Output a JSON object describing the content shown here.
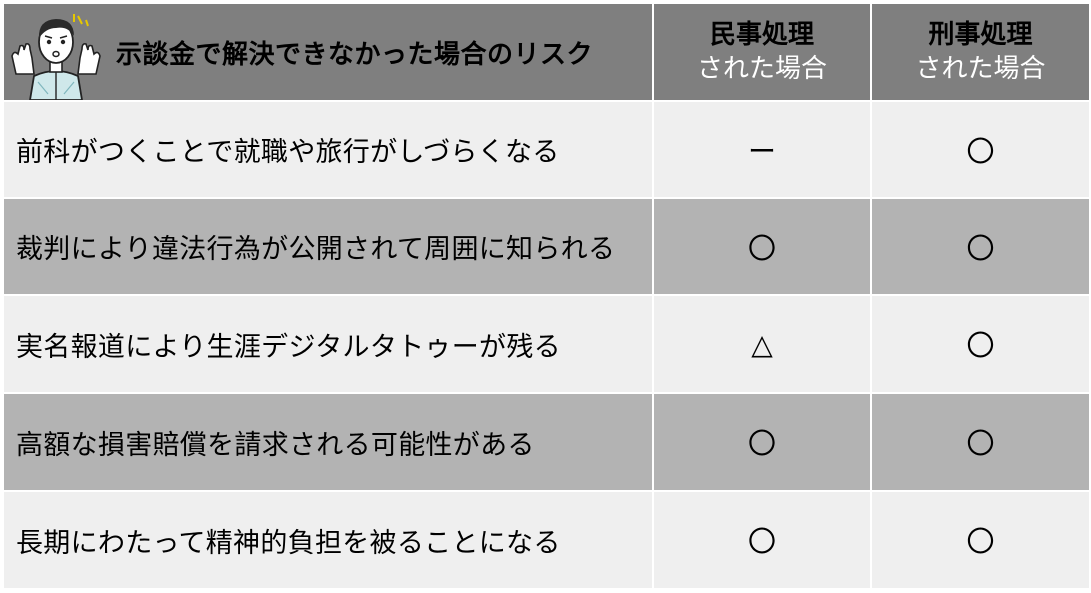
{
  "header": {
    "title": "示談金で解決できなかった場合のリスク",
    "columns": [
      {
        "line1": "民事処理",
        "line2": "された場合"
      },
      {
        "line1": "刑事処理",
        "line2": "された場合"
      }
    ]
  },
  "rows": [
    {
      "risk": "前科がつくことで就職や旅行がしづらくなる",
      "civil": "ー",
      "criminal": "〇"
    },
    {
      "risk": "裁判により違法行為が公開されて周囲に知られる",
      "civil": "〇",
      "criminal": "〇"
    },
    {
      "risk": "実名報道により生涯デジタルタトゥーが残る",
      "civil": "△",
      "criminal": "〇"
    },
    {
      "risk": "高額な損害賠償を請求される可能性がある",
      "civil": "〇",
      "criminal": "〇"
    },
    {
      "risk": "長期にわたって精神的負担を被ることになる",
      "civil": "〇",
      "criminal": "〇"
    }
  ],
  "colors": {
    "header_bg": "#7f7f7f",
    "row_light": "#efefef",
    "row_dark": "#b3b3b3"
  },
  "icons": {
    "header_illustration": "worried-person-icon"
  }
}
